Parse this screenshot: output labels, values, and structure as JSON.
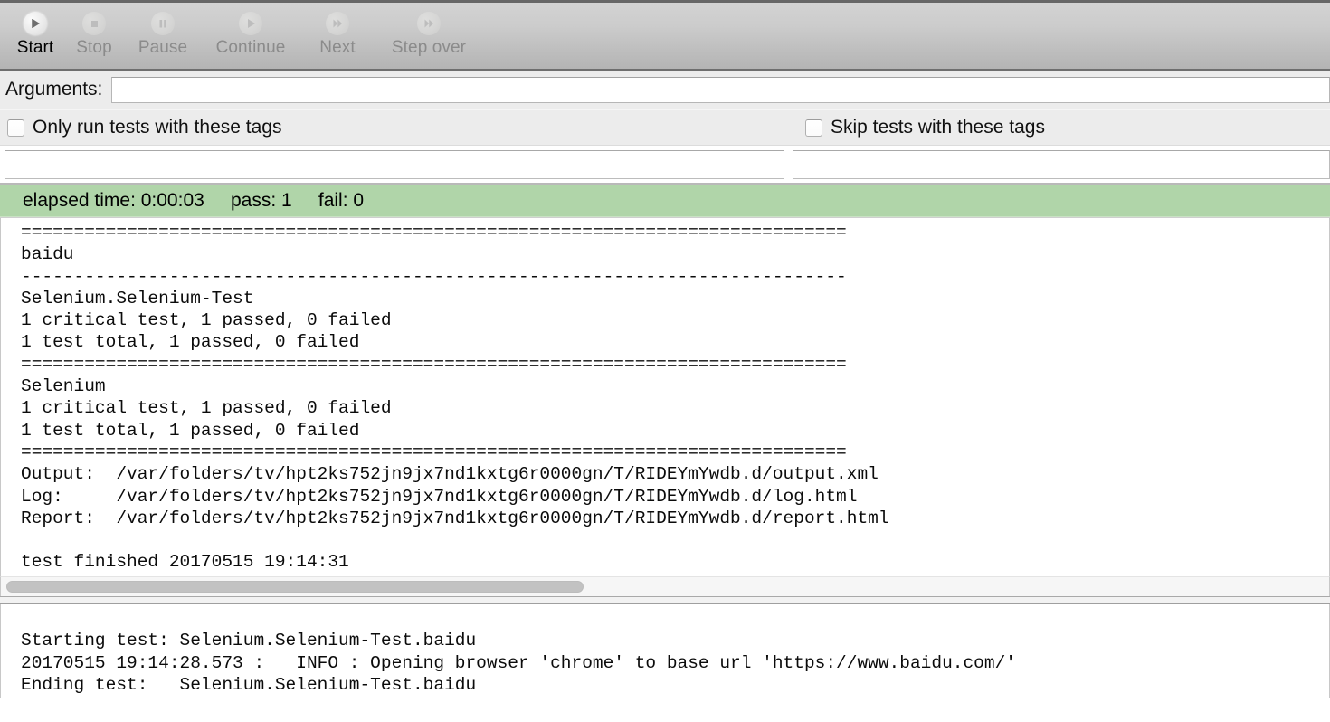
{
  "toolbar": {
    "buttons": [
      {
        "label": "Start",
        "icon": "play-icon",
        "enabled": true
      },
      {
        "label": "Stop",
        "icon": "stop-square-icon",
        "enabled": false
      },
      {
        "label": "Pause",
        "icon": "pause-icon",
        "enabled": false
      },
      {
        "label": "Continue",
        "icon": "play-icon",
        "enabled": false
      },
      {
        "label": "Next",
        "icon": "fast-forward-icon",
        "enabled": false
      },
      {
        "label": "Step over",
        "icon": "fast-forward-icon",
        "enabled": false
      }
    ]
  },
  "arguments": {
    "label": "Arguments:",
    "value": "",
    "placeholder": ""
  },
  "tags": {
    "include": {
      "checkbox_label": "Only run tests with these tags",
      "checked": false,
      "value": "",
      "placeholder": ""
    },
    "exclude": {
      "checkbox_label": "Skip tests with these tags",
      "checked": false,
      "value": "",
      "placeholder": ""
    }
  },
  "status": {
    "text": "elapsed time: 0:00:03     pass: 1     fail: 0",
    "elapsed_time": "0:00:03",
    "pass": "1",
    "fail": "0",
    "background_color": "#b0d5a9"
  },
  "output_console": {
    "lines": [
      "==============================================================================",
      "baidu",
      "------------------------------------------------------------------------------",
      "Selenium.Selenium-Test",
      "1 critical test, 1 passed, 0 failed",
      "1 test total, 1 passed, 0 failed",
      "==============================================================================",
      "Selenium",
      "1 critical test, 1 passed, 0 failed",
      "1 test total, 1 passed, 0 failed",
      "==============================================================================",
      "Output:  /var/folders/tv/hpt2ks752jn9jx7nd1kxtg6r0000gn/T/RIDEYmYwdb.d/output.xml",
      "Log:     /var/folders/tv/hpt2ks752jn9jx7nd1kxtg6r0000gn/T/RIDEYmYwdb.d/log.html",
      "Report:  /var/folders/tv/hpt2ks752jn9jx7nd1kxtg6r0000gn/T/RIDEYmYwdb.d/report.html",
      "",
      "test finished 20170515 19:14:31"
    ]
  },
  "message_console": {
    "lines": [
      "",
      "Starting test: Selenium.Selenium-Test.baidu",
      "20170515 19:14:28.573 :   INFO : Opening browser 'chrome' to base url 'https://www.baidu.com/'",
      "Ending test:   Selenium.Selenium-Test.baidu"
    ]
  }
}
